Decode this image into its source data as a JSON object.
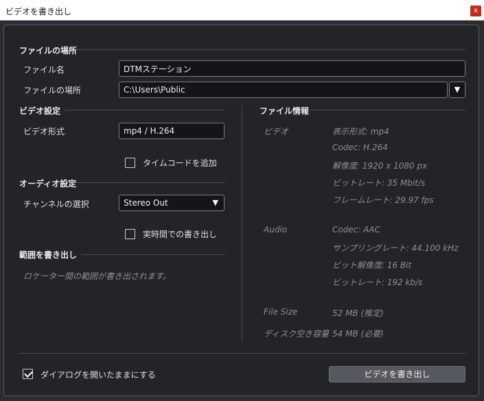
{
  "window": {
    "title": "ビデオを書き出し",
    "close_label": "x"
  },
  "location_section": {
    "title": "ファイルの場所",
    "filename_label": "ファイル名",
    "filename_value": "DTMステーション",
    "path_label": "ファイルの場所",
    "path_value": "C:\\Users\\Public",
    "path_dropdown_glyph": "▼"
  },
  "video_settings": {
    "title": "ビデオ設定",
    "format_label": "ビデオ形式",
    "format_value": "mp4 / H.264",
    "timecode_label": "タイムコードを追加",
    "timecode_checked": false
  },
  "audio_settings": {
    "title": "オーディオ設定",
    "channel_label": "チャンネルの選択",
    "channel_value": "Stereo Out",
    "channel_dropdown_glyph": "▼",
    "realtime_label": "実時間での書き出し",
    "realtime_checked": false
  },
  "range_section": {
    "title": "範囲を書き出し",
    "description": "ロケーター間の範囲が書き出されます。"
  },
  "file_info": {
    "title": "ファイル情報",
    "video_label": "ビデオ",
    "video_lines": [
      "表示形式: mp4",
      "Codec: H.264",
      "解像度: 1920 x 1080 px",
      "ビットレート: 35 Mbit/s",
      "フレームレート: 29.97 fps"
    ],
    "audio_label": "Audio",
    "audio_lines": [
      "Codec: AAC",
      "サンプリングレート: 44.100 kHz",
      "ビット解像度: 16 Bit",
      "ビットレート: 192 kb/s"
    ],
    "filesize_label": "File Size",
    "filesize_value": "52 MB (推定)",
    "diskspace_label": "ディスク空き容量",
    "diskspace_value": "54 MB (必要)"
  },
  "footer": {
    "keep_open_label": "ダイアログを開いたままにする",
    "keep_open_checked": true,
    "export_button": "ビデオを書き出し"
  },
  "colors": {
    "background": "#222428",
    "close_button": "#c42b1c",
    "field_background": "#141518",
    "button_background": "#55585e"
  }
}
